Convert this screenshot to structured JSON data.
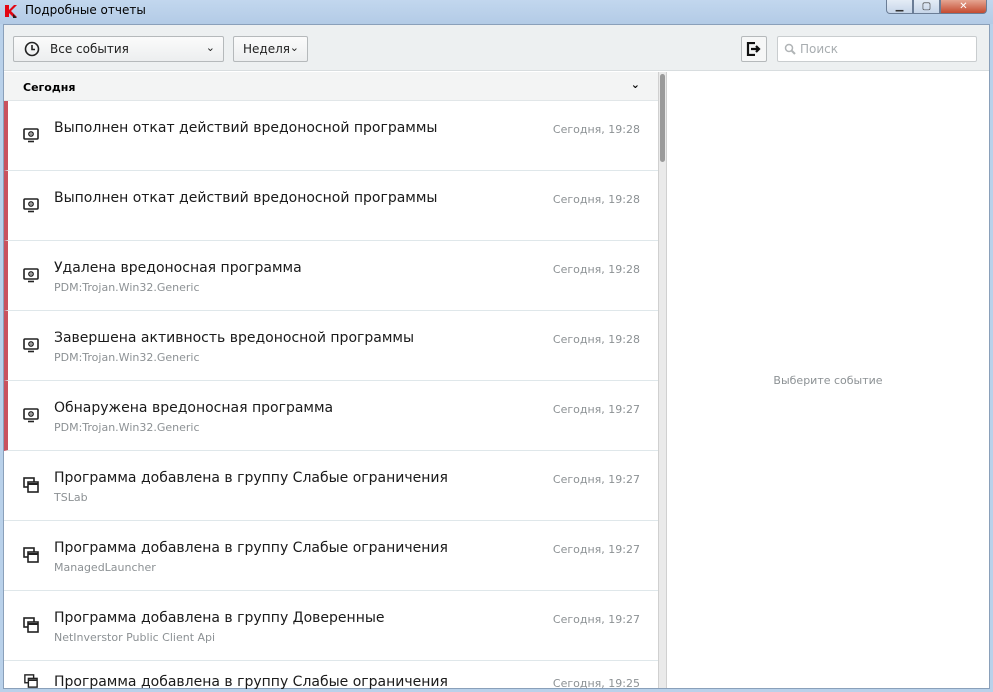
{
  "window": {
    "title": "Подробные отчеты"
  },
  "toolbar": {
    "event_filter": "Все события",
    "period_filter": "Неделя",
    "search_placeholder": "Поиск"
  },
  "group": {
    "label": "Сегодня"
  },
  "events": [
    {
      "title": "Выполнен откат действий вредоносной программы",
      "subtitle": "",
      "time": "Сегодня, 19:28",
      "severity": "critical",
      "icon": "monitor-eye-icon"
    },
    {
      "title": "Выполнен откат действий вредоносной программы",
      "subtitle": "",
      "time": "Сегодня, 19:28",
      "severity": "critical",
      "icon": "monitor-eye-icon"
    },
    {
      "title": "Удалена вредоносная программа",
      "subtitle": "PDM:Trojan.Win32.Generic",
      "time": "Сегодня, 19:28",
      "severity": "critical",
      "icon": "monitor-eye-icon"
    },
    {
      "title": "Завершена активность вредоносной программы",
      "subtitle": "PDM:Trojan.Win32.Generic",
      "time": "Сегодня, 19:28",
      "severity": "critical",
      "icon": "monitor-eye-icon"
    },
    {
      "title": "Обнаружена вредоносная программа",
      "subtitle": "PDM:Trojan.Win32.Generic",
      "time": "Сегодня, 19:27",
      "severity": "critical",
      "icon": "monitor-eye-icon"
    },
    {
      "title": "Программа добавлена в группу Слабые ограничения",
      "subtitle": "TSLab",
      "time": "Сегодня, 19:27",
      "severity": "info",
      "icon": "windows-icon"
    },
    {
      "title": "Программа добавлена в группу Слабые ограничения",
      "subtitle": "ManagedLauncher",
      "time": "Сегодня, 19:27",
      "severity": "info",
      "icon": "windows-icon"
    },
    {
      "title": "Программа добавлена в группу Доверенные",
      "subtitle": "NetInverstor Public Client Api",
      "time": "Сегодня, 19:27",
      "severity": "info",
      "icon": "windows-icon"
    },
    {
      "title": "Программа добавлена в группу Слабые ограничения",
      "subtitle": "",
      "time": "Сегодня, 19:25",
      "severity": "info",
      "icon": "windows-icon"
    }
  ],
  "details": {
    "placeholder": "Выберите событие"
  },
  "colors": {
    "critical": "#c9525e",
    "accent": "#e30613"
  }
}
